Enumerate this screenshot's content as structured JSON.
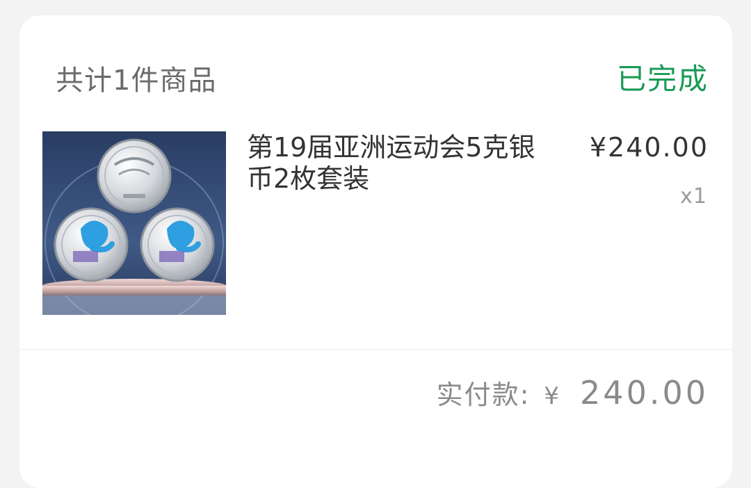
{
  "order": {
    "summary": "共计1件商品",
    "status": "已完成",
    "status_color": "#1a9a55"
  },
  "item": {
    "title": "第19届亚洲运动会5克银币2枚套装",
    "price": "¥240.00",
    "quantity": "x1",
    "image_icon": "silver-coin-set-image"
  },
  "payment": {
    "label": "实付款:",
    "currency": "¥",
    "amount": "240.00"
  }
}
